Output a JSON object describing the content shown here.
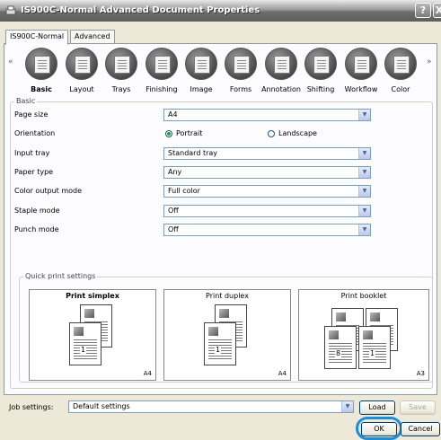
{
  "window": {
    "title": "IS900C-Normal Advanced Document Properties",
    "help": "?",
    "close": "X"
  },
  "tabs": [
    {
      "label": "IS900C-Normal",
      "active": true
    },
    {
      "label": "Advanced",
      "active": false
    }
  ],
  "categories": {
    "prev": "«",
    "next": "»",
    "items": [
      {
        "label": "Basic",
        "icon": "basic-document-icon",
        "active": true
      },
      {
        "label": "Layout",
        "icon": "layout-icon"
      },
      {
        "label": "Trays",
        "icon": "trays-icon"
      },
      {
        "label": "Finishing",
        "icon": "finishing-icon"
      },
      {
        "label": "Image",
        "icon": "image-icon"
      },
      {
        "label": "Forms",
        "icon": "forms-icon"
      },
      {
        "label": "Annotation",
        "icon": "annotation-icon"
      },
      {
        "label": "Shifting",
        "icon": "shifting-icon"
      },
      {
        "label": "Workflow",
        "icon": "workflow-icon"
      },
      {
        "label": "Color",
        "icon": "color-icon"
      }
    ]
  },
  "basic": {
    "group_title": "Basic",
    "page_size": {
      "label": "Page size",
      "value": "A4"
    },
    "orientation": {
      "label": "Orientation",
      "portrait": "Portrait",
      "landscape": "Landscape",
      "selected": "Portrait"
    },
    "input_tray": {
      "label": "Input tray",
      "value": "Standard tray"
    },
    "paper_type": {
      "label": "Paper type",
      "value": "Any"
    },
    "color_output_mode": {
      "label": "Color output mode",
      "value": "Full color"
    },
    "staple_mode": {
      "label": "Staple mode",
      "value": "Off"
    },
    "punch_mode": {
      "label": "Punch mode",
      "value": "Off"
    }
  },
  "quick_print": {
    "group_title": "Quick print settings",
    "cards": [
      {
        "title": "Print simplex",
        "paper": "A4",
        "pages": [
          "2",
          "1"
        ],
        "active": true
      },
      {
        "title": "Print duplex",
        "paper": "A4",
        "pages": [
          "3",
          "1"
        ],
        "active": false
      },
      {
        "title": "Print booklet",
        "paper": "A3",
        "pages": [
          "6",
          "3",
          "8",
          "1"
        ],
        "active": false
      }
    ]
  },
  "footer": {
    "job_settings_label": "Job settings:",
    "job_settings_value": "Default settings",
    "load": "Load",
    "save": "Save",
    "ok": "OK",
    "cancel": "Cancel"
  },
  "colors": {
    "highlight": "#1c8ed8",
    "titlebar": "#6e6e6e",
    "panel": "#fcfcfe"
  }
}
